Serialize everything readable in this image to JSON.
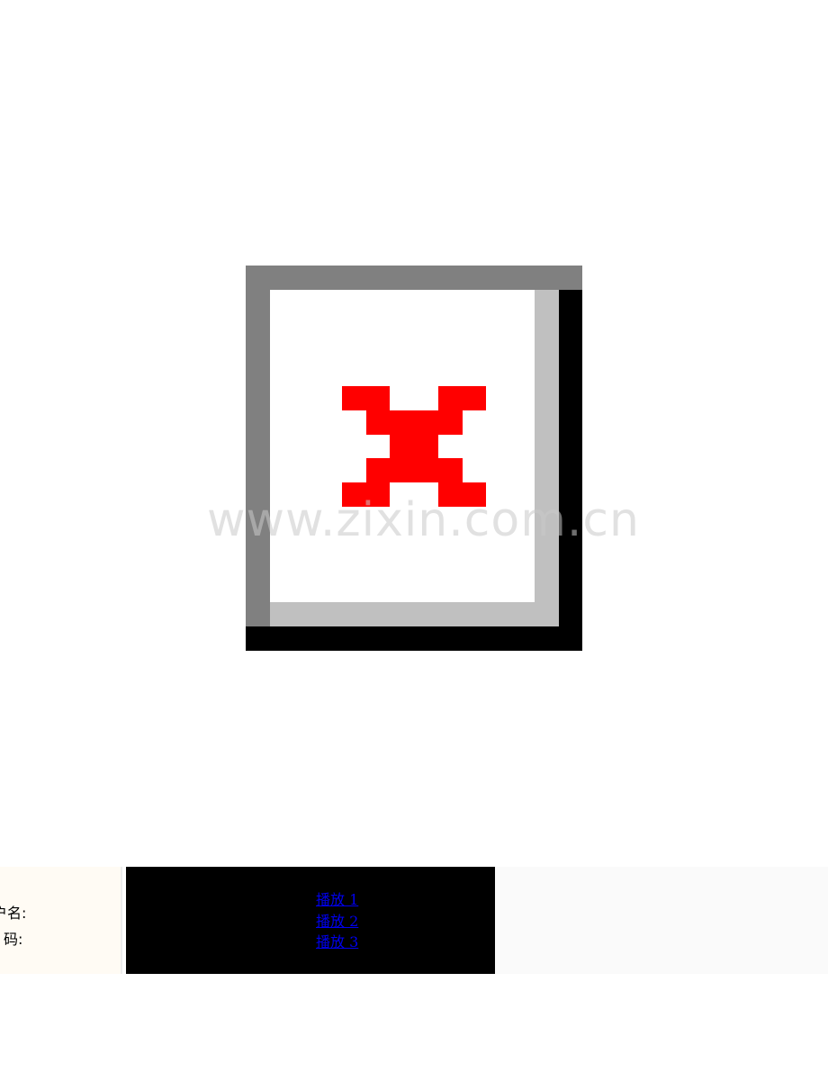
{
  "broken_image": {
    "icon": "broken-image-icon",
    "colors": {
      "outer_dark": "#000000",
      "outer_mid": "#808080",
      "inner_light": "#c0c0c0",
      "face": "#ffffff",
      "cross": "#ff0000"
    }
  },
  "watermark": {
    "text": "www.zixin.com.cn"
  },
  "login": {
    "username_label": "户名:",
    "password_label": "码:"
  },
  "player": {
    "links": [
      "播放 1",
      "播放 2",
      "播放 3"
    ]
  }
}
